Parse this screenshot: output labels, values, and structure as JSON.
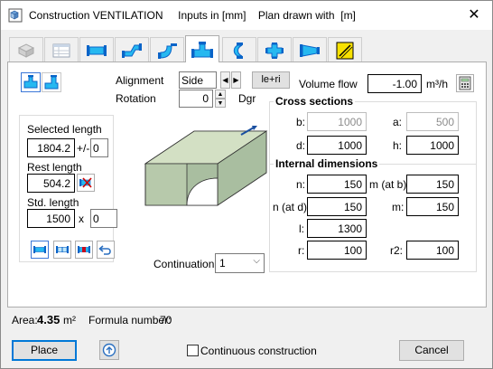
{
  "title": "Construction VENTILATION     Inputs in [mm]    Plan drawn with  [m]",
  "tabs": [
    {
      "icon": "cube-icon"
    },
    {
      "icon": "table-icon"
    },
    {
      "icon": "straight-duct-icon"
    },
    {
      "icon": "offset-duct-icon"
    },
    {
      "icon": "elbow-duct-icon"
    },
    {
      "icon": "tee-duct-icon"
    },
    {
      "icon": "bracket-duct-icon"
    },
    {
      "icon": "cross-duct-icon"
    },
    {
      "icon": "reducer-duct-icon"
    },
    {
      "icon": "damper-icon"
    }
  ],
  "alignment": {
    "label": "Alignment",
    "value": "Side",
    "button": "le+ri"
  },
  "rotation": {
    "label": "Rotation",
    "value": "0",
    "unit": "Dgr"
  },
  "volume_flow": {
    "label": "Volume flow",
    "value": "-1.00",
    "unit": "m³/h"
  },
  "length": {
    "selected_label": "Selected length",
    "selected_value": "1804.2",
    "plusminus": "+/-",
    "plusminus_value": "0",
    "rest_label": "Rest length",
    "rest_value": "504.2",
    "std_label": "Std. length",
    "std_value": "1500",
    "x_label": "x",
    "x_value": "0"
  },
  "cross_sections": {
    "title": "Cross sections",
    "b_label": "b:",
    "b_value": "1000",
    "a_label": "a:",
    "a_value": "500",
    "d_label": "d:",
    "d_value": "1000",
    "h_label": "h:",
    "h_value": "1000"
  },
  "internal_dimensions": {
    "title": "Internal dimensions",
    "n_label": "n:",
    "n_value": "150",
    "m_atb_label": "m (at b):",
    "m_atb_value": "150",
    "n_atd_label": "n (at d):",
    "n_atd_value": "150",
    "m_label": "m:",
    "m_value": "150",
    "l_label": "l:",
    "l_value": "1300",
    "r_label": "r:",
    "r_value": "100",
    "r2_label": "r2:",
    "r2_value": "100"
  },
  "continuation": {
    "label": "Continuation",
    "value": "1"
  },
  "area": {
    "label": "Area:",
    "value": "4.35",
    "unit": "m²"
  },
  "formula": {
    "label": "Formula number:",
    "value": "70"
  },
  "footer": {
    "place": "Place",
    "continuous": "Continuous construction",
    "cancel": "Cancel"
  },
  "colors": {
    "accent": "#0078d7",
    "duct_face": "#c9d8b9",
    "duct_side": "#a9bea0"
  }
}
